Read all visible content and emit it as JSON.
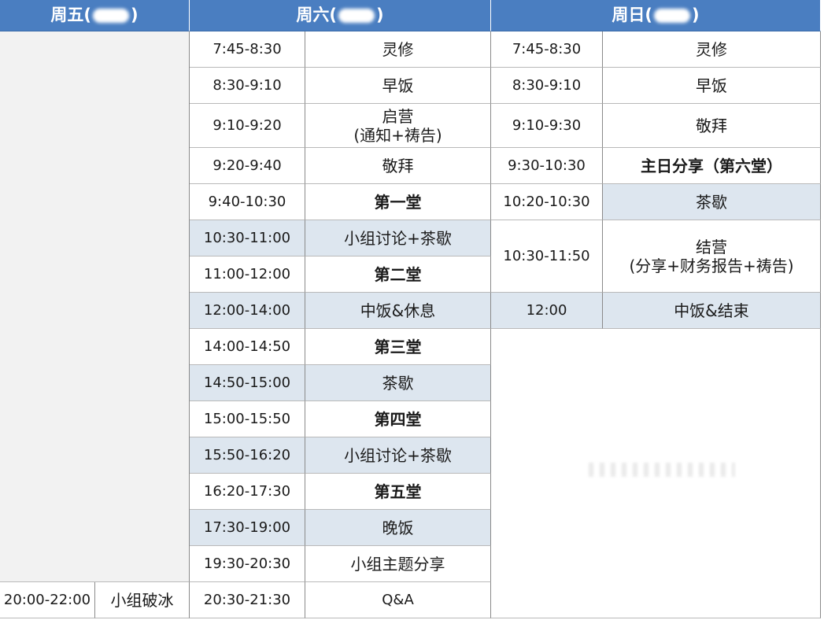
{
  "headers": {
    "fri": {
      "day": "周五",
      "open": "(",
      "close": ")"
    },
    "sat": {
      "day": "周六",
      "open": "(",
      "close": ")"
    },
    "sun": {
      "day": "周日",
      "open": "(",
      "close": ")"
    }
  },
  "friday": {
    "time": "20:00-22:00",
    "event": "小组破冰"
  },
  "saturday": [
    {
      "time": "7:45-8:30",
      "event": "灵修"
    },
    {
      "time": "8:30-9:10",
      "event": "早饭"
    },
    {
      "time": "9:10-9:20",
      "event_line1": "启营",
      "event_line2": "(通知+祷告)"
    },
    {
      "time": "9:20-9:40",
      "event": "敬拜"
    },
    {
      "time": "9:40-10:30",
      "event": "第一堂"
    },
    {
      "time": "10:30-11:00",
      "event": "小组讨论+茶歇"
    },
    {
      "time": "11:00-12:00",
      "event": "第二堂"
    },
    {
      "time": "12:00-14:00",
      "event": "中饭&休息"
    },
    {
      "time": "14:00-14:50",
      "event": "第三堂"
    },
    {
      "time": "14:50-15:00",
      "event": "茶歇"
    },
    {
      "time": "15:00-15:50",
      "event": "第四堂"
    },
    {
      "time": "15:50-16:20",
      "event": "小组讨论+茶歇"
    },
    {
      "time": "16:20-17:30",
      "event": "第五堂"
    },
    {
      "time": "17:30-19:00",
      "event": "晚饭"
    },
    {
      "time": "19:30-20:30",
      "event": "小组主题分享"
    },
    {
      "time": "20:30-21:30",
      "event": "Q&A"
    }
  ],
  "sunday": [
    {
      "time": "7:45-8:30",
      "event": "灵修"
    },
    {
      "time": "8:30-9:10",
      "event": "早饭"
    },
    {
      "time": "9:10-9:30",
      "event": "敬拜"
    },
    {
      "time": "9:30-10:30",
      "event": "主日分享（第六堂）"
    },
    {
      "time": "10:20-10:30",
      "event": "茶歇"
    },
    {
      "time": "10:30-11:50",
      "event_line1": "结营",
      "event_line2": "(分享+财务报告+祷告)"
    },
    {
      "time": "12:00",
      "event": "中饭&结束"
    }
  ]
}
